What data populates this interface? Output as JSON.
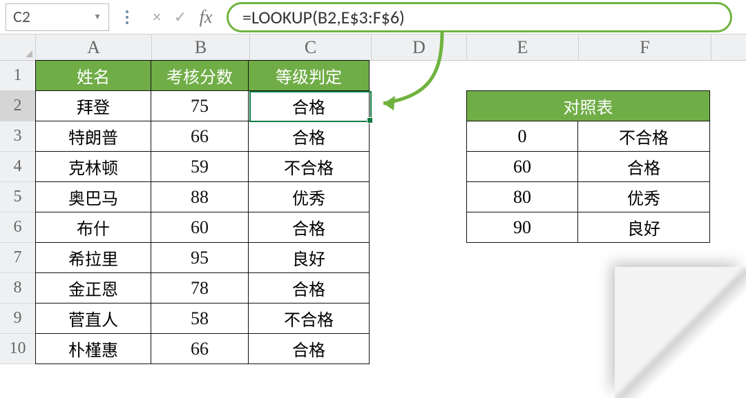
{
  "nameBox": {
    "value": "C2"
  },
  "formulaBar": {
    "cancel_icon": "×",
    "enter_icon": "✓",
    "fx_label": "fx",
    "formula": "=LOOKUP(B2,E$3:F$6)"
  },
  "colHeaders": [
    "A",
    "B",
    "C",
    "D",
    "E",
    "F"
  ],
  "rowHeaders": [
    "1",
    "2",
    "3",
    "4",
    "5",
    "6",
    "7",
    "8",
    "9",
    "10"
  ],
  "mainTable": {
    "headers": [
      "姓名",
      "考核分数",
      "等级判定"
    ],
    "rows": [
      {
        "name": "拜登",
        "score": "75",
        "grade": "合格"
      },
      {
        "name": "特朗普",
        "score": "66",
        "grade": "合格"
      },
      {
        "name": "克林顿",
        "score": "59",
        "grade": "不合格"
      },
      {
        "name": "奥巴马",
        "score": "88",
        "grade": "优秀"
      },
      {
        "name": "布什",
        "score": "60",
        "grade": "合格"
      },
      {
        "name": "希拉里",
        "score": "95",
        "grade": "良好"
      },
      {
        "name": "金正恩",
        "score": "78",
        "grade": "合格"
      },
      {
        "name": "菅直人",
        "score": "58",
        "grade": "不合格"
      },
      {
        "name": "朴槿惠",
        "score": "66",
        "grade": "合格"
      }
    ]
  },
  "lookupTable": {
    "title": "对照表",
    "rows": [
      {
        "min": "0",
        "label": "不合格"
      },
      {
        "min": "60",
        "label": "合格"
      },
      {
        "min": "80",
        "label": "优秀"
      },
      {
        "min": "90",
        "label": "良好"
      }
    ]
  },
  "colors": {
    "green": "#70ad47",
    "formulaBorder": "#6fb33e",
    "activeCell": "#107c41"
  }
}
